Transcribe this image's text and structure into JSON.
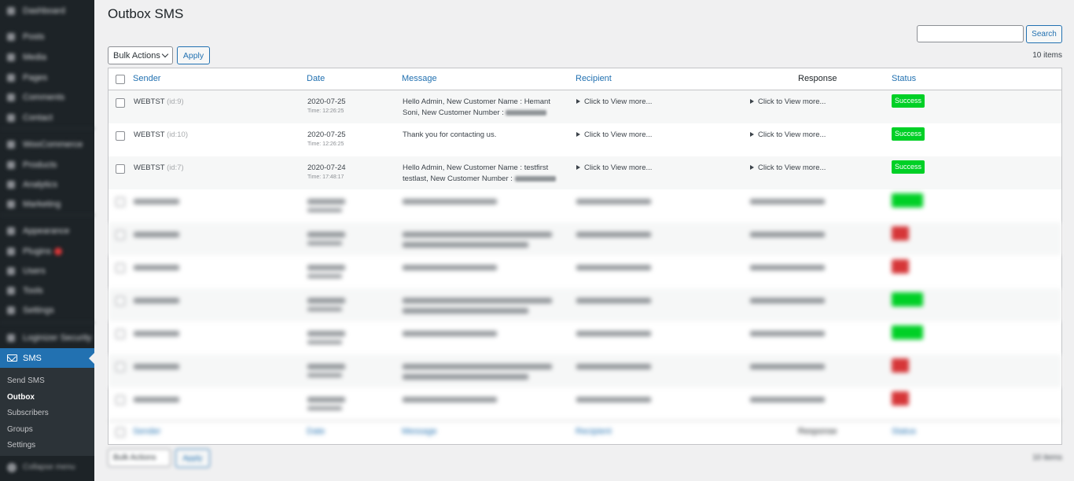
{
  "sidebar": {
    "top_items": [
      {
        "label": "Dashboard",
        "icon": "dashboard-icon"
      },
      {
        "label": "Posts",
        "icon": "pin-icon"
      },
      {
        "label": "Media",
        "icon": "media-icon"
      },
      {
        "label": "Pages",
        "icon": "pages-icon"
      },
      {
        "label": "Comments",
        "icon": "comments-icon"
      },
      {
        "label": "Contact",
        "icon": "mail-icon"
      },
      {
        "label": "WooCommerce",
        "icon": "woocommerce-icon"
      },
      {
        "label": "Products",
        "icon": "products-icon"
      },
      {
        "label": "Analytics",
        "icon": "analytics-icon"
      },
      {
        "label": "Marketing",
        "icon": "marketing-icon"
      },
      {
        "label": "Appearance",
        "icon": "appearance-icon"
      },
      {
        "label": "Plugins",
        "icon": "plugins-icon"
      },
      {
        "label": "Users",
        "icon": "users-icon"
      },
      {
        "label": "Tools",
        "icon": "tools-icon"
      },
      {
        "label": "Settings",
        "icon": "settings-icon"
      },
      {
        "label": "Loginizer Security",
        "icon": "shield-icon"
      }
    ],
    "sms_menu": {
      "label": "SMS",
      "icon": "envelope-icon"
    },
    "submenu": [
      {
        "label": "Send SMS",
        "current": false
      },
      {
        "label": "Outbox",
        "current": true
      },
      {
        "label": "Subscribers",
        "current": false
      },
      {
        "label": "Groups",
        "current": false
      },
      {
        "label": "Settings",
        "current": false
      }
    ],
    "collapse_label": "Collapse menu"
  },
  "page": {
    "title": "Outbox SMS",
    "search_button": "Search",
    "search_value": "",
    "bulk_actions": "Bulk Actions",
    "apply": "Apply",
    "item_count": "10 items"
  },
  "table": {
    "columns": {
      "sender": "Sender",
      "date": "Date",
      "message": "Message",
      "recipient": "Recipient",
      "response": "Response",
      "status": "Status"
    },
    "rows": [
      {
        "sender": "WEBTST",
        "id": "(id:9)",
        "date": "2020-07-25",
        "time": "Time: 12:26:25",
        "message": "Hello Admin, New Customer Name : Hemant Soni, New Customer Number :",
        "recipient": "Click to View more...",
        "response": "Click to View more...",
        "status": "Success"
      },
      {
        "sender": "WEBTST",
        "id": "(id:10)",
        "date": "2020-07-25",
        "time": "Time: 12:26:25",
        "message": "Thank you for contacting us.",
        "recipient": "Click to View more...",
        "response": "Click to View more...",
        "status": "Success"
      },
      {
        "sender": "WEBTST",
        "id": "(id:7)",
        "date": "2020-07-24",
        "time": "Time: 17:48:17",
        "message": "Hello Admin, New Customer Name : testfirst testlast, New Customer Number :",
        "recipient": "Click to View more...",
        "response": "Click to View more...",
        "status": "Success"
      }
    ],
    "blurred_rows": [
      {
        "two_line": false,
        "status_color": "#00d026"
      },
      {
        "two_line": true,
        "status_color": "#d63638"
      },
      {
        "two_line": false,
        "status_color": "#d63638"
      },
      {
        "two_line": true,
        "status_color": "#00d026"
      },
      {
        "two_line": false,
        "status_color": "#00d026"
      },
      {
        "two_line": true,
        "status_color": "#d63638"
      },
      {
        "two_line": false,
        "status_color": "#d63638"
      }
    ]
  },
  "colors": {
    "accent": "#2271b1",
    "success": "#00d026",
    "failed": "#d63638",
    "sidebar": "#1d2327"
  }
}
